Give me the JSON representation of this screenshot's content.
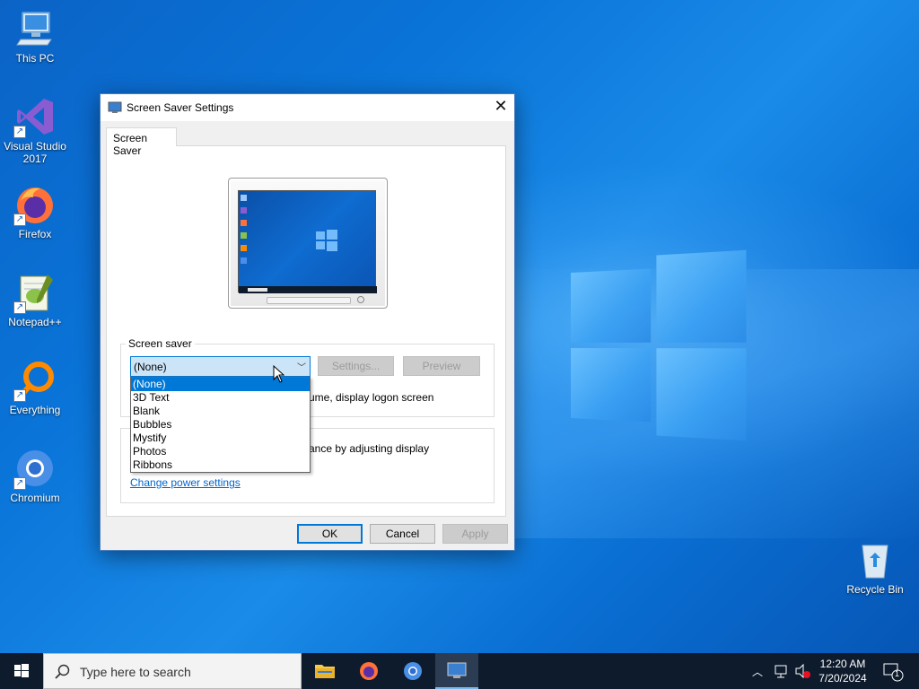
{
  "desktop": {
    "icons": [
      {
        "label": "This PC"
      },
      {
        "label": "Visual Studio 2017"
      },
      {
        "label": "Firefox"
      },
      {
        "label": "Notepad++"
      },
      {
        "label": "Everything"
      },
      {
        "label": "Chromium"
      },
      {
        "label": "Recycle Bin"
      }
    ]
  },
  "dialog": {
    "title": "Screen Saver Settings",
    "close_icon": "close-icon",
    "tab": "Screen Saver",
    "screensaver_group": {
      "label": "Screen saver",
      "selected": "(None)",
      "settings_btn": "Settings...",
      "preview_btn": "Preview",
      "logon_text_partial": "ume, display logon screen"
    },
    "power_group": {
      "text_partial": "ance by adjusting display",
      "link": "Change power settings"
    },
    "dropdown_options": [
      "(None)",
      "3D Text",
      "Blank",
      "Bubbles",
      "Mystify",
      "Photos",
      "Ribbons"
    ],
    "buttons": {
      "ok": "OK",
      "cancel": "Cancel",
      "apply": "Apply"
    }
  },
  "taskbar": {
    "search_placeholder": "Type here to search",
    "time": "12:20 AM",
    "date": "7/20/2024",
    "notification_count": "1"
  },
  "colors": {
    "accent": "#0078d7",
    "link": "#0066cc",
    "taskbar": "#0d1b2c"
  }
}
